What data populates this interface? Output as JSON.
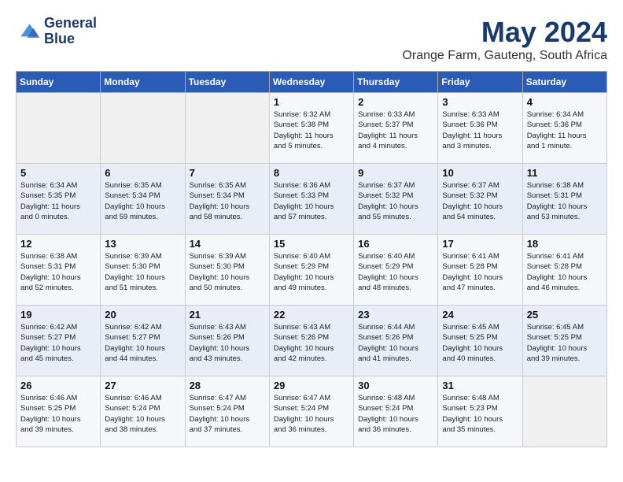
{
  "header": {
    "logo_line1": "General",
    "logo_line2": "Blue",
    "month": "May 2024",
    "location": "Orange Farm, Gauteng, South Africa"
  },
  "days_of_week": [
    "Sunday",
    "Monday",
    "Tuesday",
    "Wednesday",
    "Thursday",
    "Friday",
    "Saturday"
  ],
  "weeks": [
    [
      {
        "day": "",
        "info": ""
      },
      {
        "day": "",
        "info": ""
      },
      {
        "day": "",
        "info": ""
      },
      {
        "day": "1",
        "info": "Sunrise: 6:32 AM\nSunset: 5:38 PM\nDaylight: 11 hours\nand 5 minutes."
      },
      {
        "day": "2",
        "info": "Sunrise: 6:33 AM\nSunset: 5:37 PM\nDaylight: 11 hours\nand 4 minutes."
      },
      {
        "day": "3",
        "info": "Sunrise: 6:33 AM\nSunset: 5:36 PM\nDaylight: 11 hours\nand 3 minutes."
      },
      {
        "day": "4",
        "info": "Sunrise: 6:34 AM\nSunset: 5:36 PM\nDaylight: 11 hours\nand 1 minute."
      }
    ],
    [
      {
        "day": "5",
        "info": "Sunrise: 6:34 AM\nSunset: 5:35 PM\nDaylight: 11 hours\nand 0 minutes."
      },
      {
        "day": "6",
        "info": "Sunrise: 6:35 AM\nSunset: 5:34 PM\nDaylight: 10 hours\nand 59 minutes."
      },
      {
        "day": "7",
        "info": "Sunrise: 6:35 AM\nSunset: 5:34 PM\nDaylight: 10 hours\nand 58 minutes."
      },
      {
        "day": "8",
        "info": "Sunrise: 6:36 AM\nSunset: 5:33 PM\nDaylight: 10 hours\nand 57 minutes."
      },
      {
        "day": "9",
        "info": "Sunrise: 6:37 AM\nSunset: 5:32 PM\nDaylight: 10 hours\nand 55 minutes."
      },
      {
        "day": "10",
        "info": "Sunrise: 6:37 AM\nSunset: 5:32 PM\nDaylight: 10 hours\nand 54 minutes."
      },
      {
        "day": "11",
        "info": "Sunrise: 6:38 AM\nSunset: 5:31 PM\nDaylight: 10 hours\nand 53 minutes."
      }
    ],
    [
      {
        "day": "12",
        "info": "Sunrise: 6:38 AM\nSunset: 5:31 PM\nDaylight: 10 hours\nand 52 minutes."
      },
      {
        "day": "13",
        "info": "Sunrise: 6:39 AM\nSunset: 5:30 PM\nDaylight: 10 hours\nand 51 minutes."
      },
      {
        "day": "14",
        "info": "Sunrise: 6:39 AM\nSunset: 5:30 PM\nDaylight: 10 hours\nand 50 minutes."
      },
      {
        "day": "15",
        "info": "Sunrise: 6:40 AM\nSunset: 5:29 PM\nDaylight: 10 hours\nand 49 minutes."
      },
      {
        "day": "16",
        "info": "Sunrise: 6:40 AM\nSunset: 5:29 PM\nDaylight: 10 hours\nand 48 minutes."
      },
      {
        "day": "17",
        "info": "Sunrise: 6:41 AM\nSunset: 5:28 PM\nDaylight: 10 hours\nand 47 minutes."
      },
      {
        "day": "18",
        "info": "Sunrise: 6:41 AM\nSunset: 5:28 PM\nDaylight: 10 hours\nand 46 minutes."
      }
    ],
    [
      {
        "day": "19",
        "info": "Sunrise: 6:42 AM\nSunset: 5:27 PM\nDaylight: 10 hours\nand 45 minutes."
      },
      {
        "day": "20",
        "info": "Sunrise: 6:42 AM\nSunset: 5:27 PM\nDaylight: 10 hours\nand 44 minutes."
      },
      {
        "day": "21",
        "info": "Sunrise: 6:43 AM\nSunset: 5:26 PM\nDaylight: 10 hours\nand 43 minutes."
      },
      {
        "day": "22",
        "info": "Sunrise: 6:43 AM\nSunset: 5:26 PM\nDaylight: 10 hours\nand 42 minutes."
      },
      {
        "day": "23",
        "info": "Sunrise: 6:44 AM\nSunset: 5:26 PM\nDaylight: 10 hours\nand 41 minutes."
      },
      {
        "day": "24",
        "info": "Sunrise: 6:45 AM\nSunset: 5:25 PM\nDaylight: 10 hours\nand 40 minutes."
      },
      {
        "day": "25",
        "info": "Sunrise: 6:45 AM\nSunset: 5:25 PM\nDaylight: 10 hours\nand 39 minutes."
      }
    ],
    [
      {
        "day": "26",
        "info": "Sunrise: 6:46 AM\nSunset: 5:25 PM\nDaylight: 10 hours\nand 39 minutes."
      },
      {
        "day": "27",
        "info": "Sunrise: 6:46 AM\nSunset: 5:24 PM\nDaylight: 10 hours\nand 38 minutes."
      },
      {
        "day": "28",
        "info": "Sunrise: 6:47 AM\nSunset: 5:24 PM\nDaylight: 10 hours\nand 37 minutes."
      },
      {
        "day": "29",
        "info": "Sunrise: 6:47 AM\nSunset: 5:24 PM\nDaylight: 10 hours\nand 36 minutes."
      },
      {
        "day": "30",
        "info": "Sunrise: 6:48 AM\nSunset: 5:24 PM\nDaylight: 10 hours\nand 36 minutes."
      },
      {
        "day": "31",
        "info": "Sunrise: 6:48 AM\nSunset: 5:23 PM\nDaylight: 10 hours\nand 35 minutes."
      },
      {
        "day": "",
        "info": ""
      }
    ]
  ]
}
